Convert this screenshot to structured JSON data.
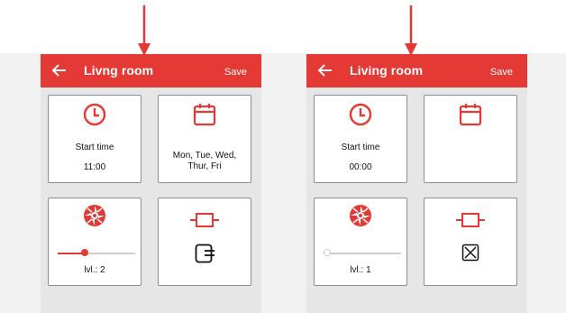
{
  "colors": {
    "accent": "#e53935",
    "card_border": "#8e8e8e",
    "background": "#f2f2f2"
  },
  "left_screen": {
    "header": {
      "title": "Livng room",
      "save_label": "Save",
      "back_icon": "arrow-left-icon"
    },
    "start_time": {
      "icon": "clock-icon",
      "label": "Start time",
      "value": "11:00"
    },
    "days": {
      "icon": "calendar-icon",
      "line1": "Mon, Tue, Wed,",
      "line2": "Thur, Fri"
    },
    "level": {
      "icon": "fan-icon",
      "label": "lvl.: 2",
      "slider_fraction": 0.33
    },
    "switch": {
      "icon": "mode-icon",
      "state_icon": "enabled-icon"
    }
  },
  "right_screen": {
    "header": {
      "title": "Living room",
      "save_label": "Save",
      "back_icon": "arrow-left-icon"
    },
    "start_time": {
      "icon": "clock-icon",
      "label": "Start time",
      "value": "00:00"
    },
    "days": {
      "icon": "calendar-icon",
      "line1": "",
      "line2": ""
    },
    "level": {
      "icon": "fan-icon",
      "label": "lvl.: 1",
      "slider_fraction": 0.0
    },
    "switch": {
      "icon": "mode-icon",
      "state_icon": "disabled-icon"
    }
  }
}
